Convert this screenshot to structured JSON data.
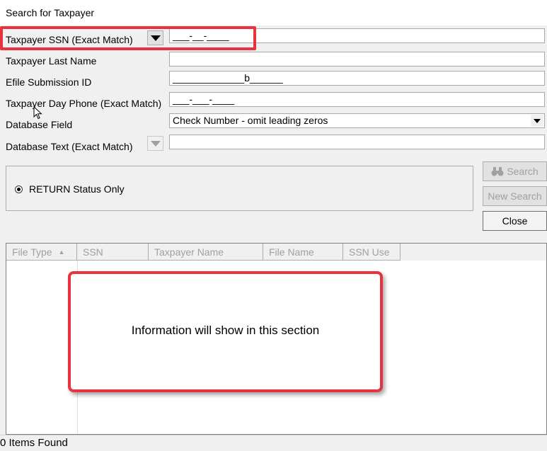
{
  "window": {
    "title": "Search for Taxpayer"
  },
  "form": {
    "ssn_label": "Taxpayer SSN (Exact Match)",
    "ssn_value": "___-__-____",
    "last_name_label": "Taxpayer Last Name",
    "last_name_value": "",
    "efile_label": "Efile Submission ID",
    "efile_value": "_____________b______",
    "phone_label": "Taxpayer Day Phone (Exact Match)",
    "phone_value": "___-___-____",
    "db_field_label": "Database Field",
    "db_field_value": "Check Number - omit leading zeros",
    "db_text_label": "Database Text (Exact Match)",
    "db_text_value": ""
  },
  "status_filter": {
    "radio_label": "RETURN Status Only",
    "selected": true
  },
  "buttons": {
    "search": "Search",
    "new_search": "New Search",
    "close": "Close"
  },
  "grid": {
    "columns": [
      {
        "label": "File Type",
        "sorted": true
      },
      {
        "label": "SSN"
      },
      {
        "label": "Taxpayer Name"
      },
      {
        "label": "File Name"
      },
      {
        "label": "SSN Use"
      }
    ]
  },
  "callout": {
    "text": "Information will show in this section"
  },
  "status_bar": {
    "text": "0 Items Found"
  },
  "colors": {
    "highlight": "#e8333e",
    "disabled_text": "#a0a0a0"
  },
  "icons": {
    "dropdown": "triangle-down",
    "search": "binoculars-icon",
    "sort": "sort-ascending-icon"
  }
}
